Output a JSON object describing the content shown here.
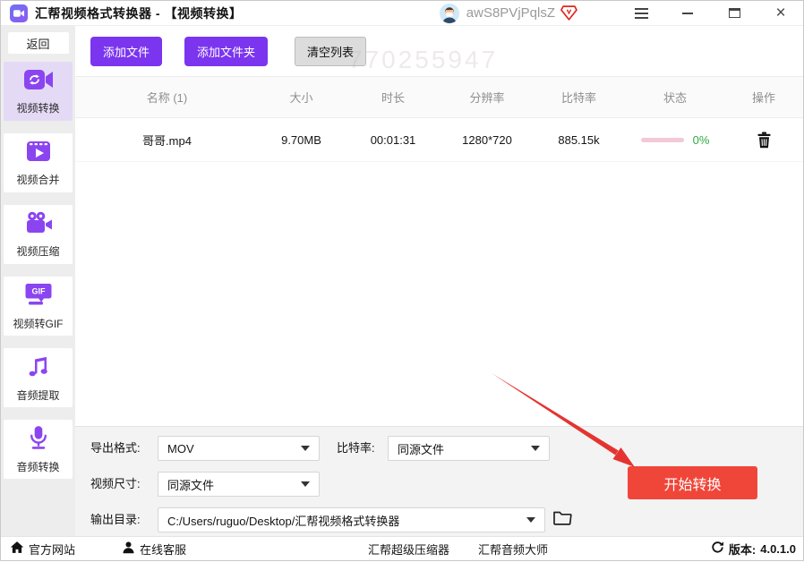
{
  "titlebar": {
    "title": "汇帮视频格式转换器 - 【视频转换】",
    "username": "awS8PVjPqlsZ",
    "icons": [
      "app-logo-icon",
      "avatar",
      "vip-badge-icon",
      "hamburger-menu-icon",
      "minimize-icon",
      "maximize-icon",
      "close-icon"
    ]
  },
  "sidebar": {
    "back_label": "返回",
    "items": [
      {
        "label": "视频转换",
        "icon": "video-convert-icon",
        "active": true
      },
      {
        "label": "视频合并",
        "icon": "video-merge-icon",
        "active": false
      },
      {
        "label": "视频压缩",
        "icon": "video-compress-icon",
        "active": false
      },
      {
        "label": "视频转GIF",
        "icon": "video-to-gif-icon",
        "active": false
      },
      {
        "label": "音频提取",
        "icon": "audio-extract-icon",
        "active": false
      },
      {
        "label": "音频转换",
        "icon": "audio-convert-icon",
        "active": false
      }
    ]
  },
  "toolbar": {
    "add_file": "添加文件",
    "add_folder": "添加文件夹",
    "clear_list": "清空列表",
    "watermark": "770255947"
  },
  "table": {
    "headers": [
      "名称 (1)",
      "大小",
      "时长",
      "分辨率",
      "比特率",
      "状态",
      "操作"
    ],
    "rows": [
      {
        "name": "哥哥.mp4",
        "size": "9.70MB",
        "duration": "00:01:31",
        "resolution": "1280*720",
        "bitrate": "885.15k",
        "progress": "0%"
      }
    ]
  },
  "settings": {
    "export_format_label": "导出格式:",
    "export_format_value": "MOV",
    "bitrate_label": "比特率:",
    "bitrate_value": "同源文件",
    "video_size_label": "视频尺寸:",
    "video_size_value": "同源文件",
    "output_dir_label": "输出目录:",
    "output_dir_value": "C:/Users/ruguo/Desktop/汇帮视频格式转换器",
    "start_button": "开始转换"
  },
  "statusbar": {
    "official_site": "官方网站",
    "online_service": "在线客服",
    "super_compressor": "汇帮超级压缩器",
    "audio_master": "汇帮音频大师",
    "version_label": "版本:",
    "version_value": "4.0.1.0"
  },
  "colors": {
    "accent_purple": "#7b35ef",
    "icon_purple": "#8b45f0",
    "active_item_bg": "#e4daf6",
    "start_red": "#f0463a",
    "arrow_red": "#e53430",
    "progress_pink": "#f3c8d8",
    "progress_green": "#2eab44"
  }
}
